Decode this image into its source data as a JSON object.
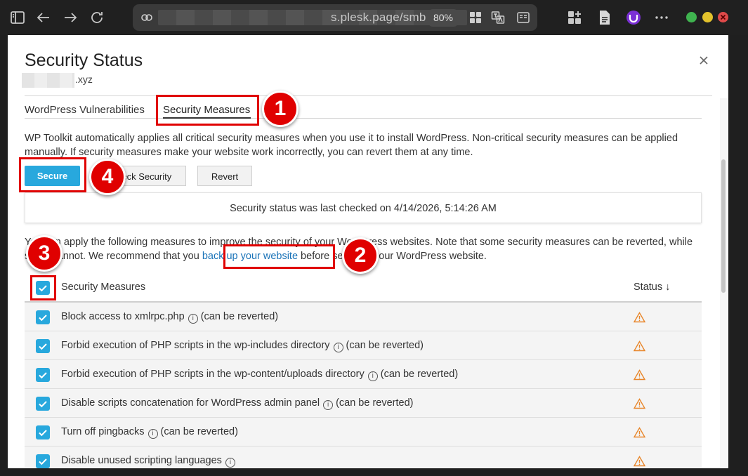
{
  "browser": {
    "url_suffix": "s.plesk.page/smb",
    "zoom": "80%"
  },
  "modal": {
    "title": "Security Status",
    "domain_suffix": ".xyz",
    "tabs": [
      "WordPress Vulnerabilities",
      "Security Measures"
    ],
    "intro": "WP Toolkit automatically applies all critical security measures when you use it to install WordPress. Non-critical security measures can be applied manually. If security measures make your website work incorrectly, you can revert them at any time.",
    "buttons": {
      "secure": "Secure",
      "check": "Check Security",
      "revert": "Revert"
    },
    "last_checked": "Security status was last checked on 4/14/2026, 5:14:26 AM",
    "note_before_link": "You can apply the following measures to improve the security of your WordPress websites. Note that some security measures can be reverted, while some cannot. We recommend that you ",
    "note_link": "back up your website",
    "note_after_link": " before securing your WordPress website.",
    "table": {
      "col_measures": "Security Measures",
      "col_status": "Status ↓",
      "rows": [
        {
          "label": "Block access to xmlrpc.php",
          "note": "(can be reverted)"
        },
        {
          "label": "Forbid execution of PHP scripts in the wp-includes directory",
          "note": "(can be reverted)"
        },
        {
          "label": "Forbid execution of PHP scripts in the wp-content/uploads directory",
          "note": "(can be reverted)"
        },
        {
          "label": "Disable scripts concatenation for WordPress admin panel",
          "note": "(can be reverted)"
        },
        {
          "label": "Turn off pingbacks",
          "note": "(can be reverted)"
        },
        {
          "label": "Disable unused scripting languages",
          "note": ""
        }
      ]
    }
  },
  "annotations": [
    "1",
    "2",
    "3",
    "4"
  ],
  "colors": {
    "accent": "#28a8dd",
    "annotation": "#e00000",
    "warning": "#e8862a",
    "link": "#1a73b8"
  }
}
